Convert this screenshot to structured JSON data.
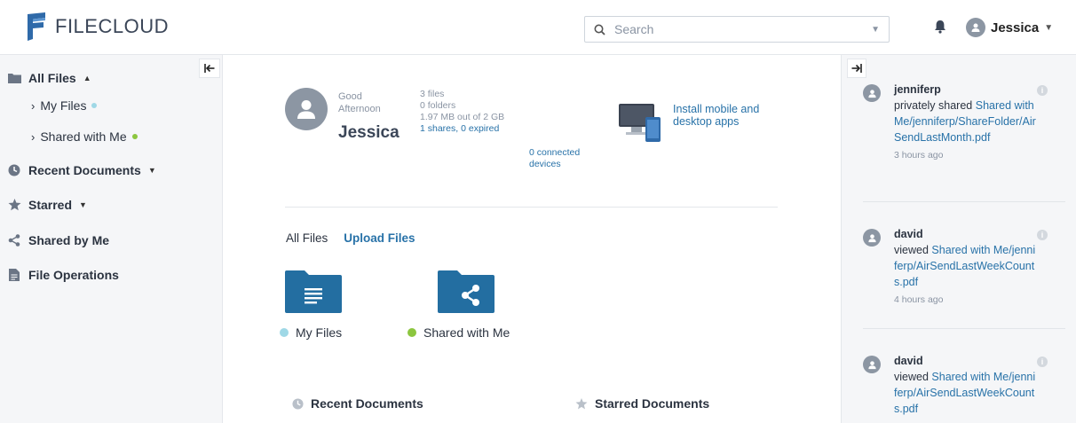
{
  "header": {
    "logo_text": "FILECLOUD",
    "search_placeholder": "Search",
    "user_name": "Jessica"
  },
  "sidebar": {
    "all_files": "All Files",
    "my_files": "My Files",
    "shared_with_me": "Shared with Me",
    "recent_documents": "Recent Documents",
    "starred": "Starred",
    "shared_by_me": "Shared by Me",
    "file_operations": "File Operations"
  },
  "main": {
    "greeting": "Good Afternoon",
    "user_name": "Jessica",
    "stats": {
      "files": "3 files",
      "folders": "0 folders",
      "usage": "1.97 MB out of 2 GB",
      "shares": "1 shares, 0 expired",
      "devices": "0 connected devices"
    },
    "install_apps": "Install mobile and desktop apps",
    "tab_all_files": "All Files",
    "tab_upload": "Upload Files",
    "folders": [
      {
        "label": "My Files",
        "dot_color": "#9fd8e6"
      },
      {
        "label": "Shared with Me",
        "dot_color": "#8cc63f"
      }
    ],
    "recent_documents": "Recent Documents",
    "starred_documents": "Starred Documents"
  },
  "activity": [
    {
      "user": "jenniferp",
      "action": "privately shared",
      "path": "Shared with Me/jenniferp/ShareFolder/AirSendLastMonth.pdf",
      "time": "3 hours ago"
    },
    {
      "user": "david",
      "action": "viewed",
      "path": "Shared with Me/jenniferp/AirSendLastWeekCounts.pdf",
      "time": "4 hours ago"
    },
    {
      "user": "david",
      "action": "viewed",
      "path": "Shared with Me/jenniferp/AirSendLastWeekCounts.pdf",
      "time": ""
    }
  ],
  "colors": {
    "accent": "#2872a8",
    "folder": "#236ea1",
    "my_files_dot": "#9fd8e6",
    "shared_dot": "#8cc63f"
  }
}
